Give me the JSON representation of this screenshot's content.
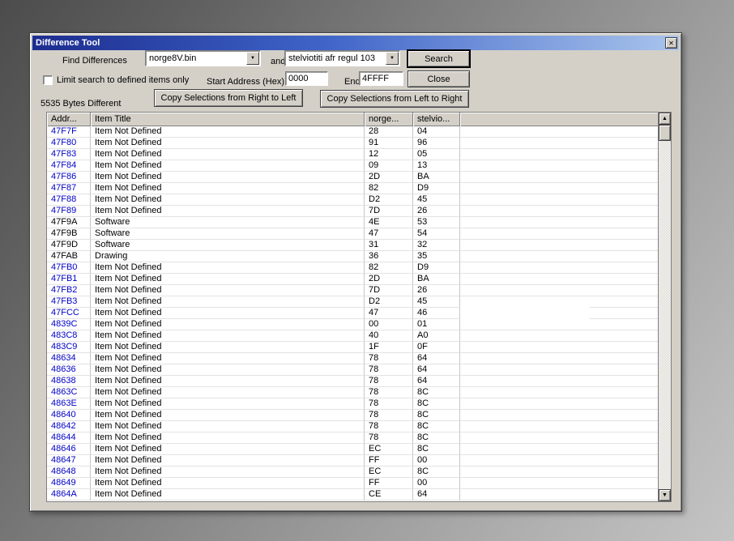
{
  "window": {
    "title": "Difference Tool",
    "close_icon": "✕"
  },
  "icons": {
    "dropdown_arrow": "▼",
    "up_arrow": "▲",
    "down_arrow": "▼"
  },
  "colors": {
    "address_undefined": "#0000c8",
    "address_defined": "#000000",
    "titlebar_left": "#1c2d8f",
    "titlebar_right": "#a9c4ec",
    "dialog_background": "#d4d0c8"
  },
  "controls": {
    "find_label": "Find Differences",
    "left_file": "norge8V.bin",
    "and_label": "and",
    "right_file": "stelviotiti afr regul 103",
    "search_button": "Search",
    "limit_checkbox_label": "Limit search to defined items only",
    "limit_checked": false,
    "start_address_label": "Start Address (Hex)",
    "start_address_value": "0000",
    "end_label": "End",
    "end_value": "4FFFF",
    "close_button": "Close",
    "bytes_different": "5535 Bytes Different",
    "copy_right_to_left": "Copy Selections from Right to Left",
    "copy_left_to_right": "Copy Selections from Left to Right"
  },
  "table": {
    "headers": [
      "Addr...",
      "Item Title",
      "norge...",
      "stelvio...",
      ""
    ],
    "rows": [
      {
        "addr": "47F7F",
        "title": "Item Not Defined",
        "left": "28",
        "right": "04",
        "defined": false
      },
      {
        "addr": "47F80",
        "title": "Item Not Defined",
        "left": "91",
        "right": "96",
        "defined": false
      },
      {
        "addr": "47F83",
        "title": "Item Not Defined",
        "left": "12",
        "right": "05",
        "defined": false
      },
      {
        "addr": "47F84",
        "title": "Item Not Defined",
        "left": "09",
        "right": "13",
        "defined": false
      },
      {
        "addr": "47F86",
        "title": "Item Not Defined",
        "left": "2D",
        "right": "BA",
        "defined": false
      },
      {
        "addr": "47F87",
        "title": "Item Not Defined",
        "left": "82",
        "right": "D9",
        "defined": false
      },
      {
        "addr": "47F88",
        "title": "Item Not Defined",
        "left": "D2",
        "right": "45",
        "defined": false
      },
      {
        "addr": "47F89",
        "title": "Item Not Defined",
        "left": "7D",
        "right": "26",
        "defined": false
      },
      {
        "addr": "47F9A",
        "title": "Software",
        "left": "4E",
        "right": "53",
        "defined": true
      },
      {
        "addr": "47F9B",
        "title": "Software",
        "left": "47",
        "right": "54",
        "defined": true
      },
      {
        "addr": "47F9D",
        "title": "Software",
        "left": "31",
        "right": "32",
        "defined": true
      },
      {
        "addr": "47FAB",
        "title": "Drawing",
        "left": "36",
        "right": "35",
        "defined": true
      },
      {
        "addr": "47FB0",
        "title": "Item Not Defined",
        "left": "82",
        "right": "D9",
        "defined": false
      },
      {
        "addr": "47FB1",
        "title": "Item Not Defined",
        "left": "2D",
        "right": "BA",
        "defined": false
      },
      {
        "addr": "47FB2",
        "title": "Item Not Defined",
        "left": "7D",
        "right": "26",
        "defined": false
      },
      {
        "addr": "47FB3",
        "title": "Item Not Defined",
        "left": "D2",
        "right": "45",
        "defined": false
      },
      {
        "addr": "47FCC",
        "title": "Item Not Defined",
        "left": "47",
        "right": "46",
        "defined": false
      },
      {
        "addr": "4839C",
        "title": "Item Not Defined",
        "left": "00",
        "right": "01",
        "defined": false
      },
      {
        "addr": "483C8",
        "title": "Item Not Defined",
        "left": "40",
        "right": "A0",
        "defined": false
      },
      {
        "addr": "483C9",
        "title": "Item Not Defined",
        "left": "1F",
        "right": "0F",
        "defined": false
      },
      {
        "addr": "48634",
        "title": "Item Not Defined",
        "left": "78",
        "right": "64",
        "defined": false
      },
      {
        "addr": "48636",
        "title": "Item Not Defined",
        "left": "78",
        "right": "64",
        "defined": false
      },
      {
        "addr": "48638",
        "title": "Item Not Defined",
        "left": "78",
        "right": "64",
        "defined": false
      },
      {
        "addr": "4863C",
        "title": "Item Not Defined",
        "left": "78",
        "right": "8C",
        "defined": false
      },
      {
        "addr": "4863E",
        "title": "Item Not Defined",
        "left": "78",
        "right": "8C",
        "defined": false
      },
      {
        "addr": "48640",
        "title": "Item Not Defined",
        "left": "78",
        "right": "8C",
        "defined": false
      },
      {
        "addr": "48642",
        "title": "Item Not Defined",
        "left": "78",
        "right": "8C",
        "defined": false
      },
      {
        "addr": "48644",
        "title": "Item Not Defined",
        "left": "78",
        "right": "8C",
        "defined": false
      },
      {
        "addr": "48646",
        "title": "Item Not Defined",
        "left": "EC",
        "right": "8C",
        "defined": false
      },
      {
        "addr": "48647",
        "title": "Item Not Defined",
        "left": "FF",
        "right": "00",
        "defined": false
      },
      {
        "addr": "48648",
        "title": "Item Not Defined",
        "left": "EC",
        "right": "8C",
        "defined": false
      },
      {
        "addr": "48649",
        "title": "Item Not Defined",
        "left": "FF",
        "right": "00",
        "defined": false
      },
      {
        "addr": "4864A",
        "title": "Item Not Defined",
        "left": "CE",
        "right": "64",
        "defined": false
      }
    ]
  }
}
